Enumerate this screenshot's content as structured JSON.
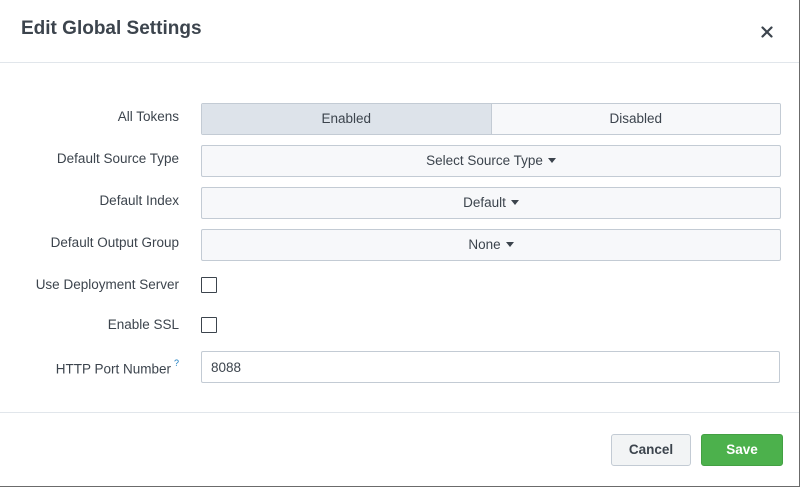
{
  "dialog": {
    "title": "Edit Global Settings",
    "close_icon": "close-icon"
  },
  "form": {
    "all_tokens": {
      "label": "All Tokens",
      "options": [
        "Enabled",
        "Disabled"
      ],
      "selected": "Enabled"
    },
    "default_source_type": {
      "label": "Default Source Type",
      "value": "Select Source Type"
    },
    "default_index": {
      "label": "Default Index",
      "value": "Default"
    },
    "default_output_group": {
      "label": "Default Output Group",
      "value": "None"
    },
    "use_deployment_server": {
      "label": "Use Deployment Server",
      "checked": false
    },
    "enable_ssl": {
      "label": "Enable SSL",
      "checked": false
    },
    "http_port_number": {
      "label": "HTTP Port Number",
      "help_mark": "?",
      "value": "8088"
    }
  },
  "footer": {
    "cancel_label": "Cancel",
    "save_label": "Save"
  },
  "colors": {
    "save_green": "#4cb14c",
    "text": "#3c444d",
    "help_blue": "#1a7cc0"
  }
}
